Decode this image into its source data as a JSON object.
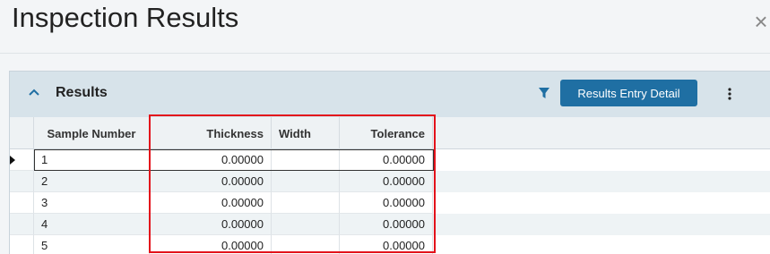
{
  "page": {
    "title": "Inspection Results"
  },
  "panel": {
    "title": "Results",
    "detail_button_label": "Results Entry Detail"
  },
  "grid": {
    "columns": [
      "Sample Number",
      "Thickness",
      "Width",
      "Tolerance"
    ],
    "rows": [
      {
        "sample": "1",
        "thickness": "0.00000",
        "width": "",
        "tolerance": "0.00000"
      },
      {
        "sample": "2",
        "thickness": "0.00000",
        "width": "",
        "tolerance": "0.00000"
      },
      {
        "sample": "3",
        "thickness": "0.00000",
        "width": "",
        "tolerance": "0.00000"
      },
      {
        "sample": "4",
        "thickness": "0.00000",
        "width": "",
        "tolerance": "0.00000"
      },
      {
        "sample": "5",
        "thickness": "0.00000",
        "width": "",
        "tolerance": "0.00000"
      }
    ]
  },
  "icons": {
    "chevron": "chevron-up-icon",
    "filter": "filter-icon",
    "more": "more-vertical-icon",
    "close": "close-icon"
  },
  "colors": {
    "accent": "#1f6fa3",
    "highlight": "#e3121b",
    "header_bg": "#d7e3ea"
  }
}
